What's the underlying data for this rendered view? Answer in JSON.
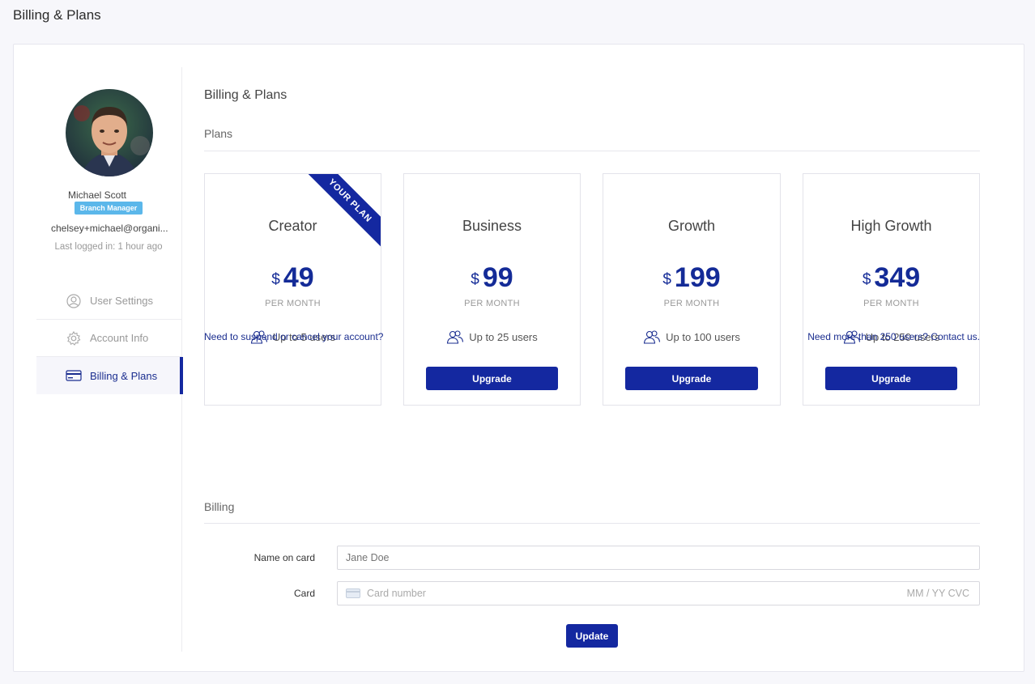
{
  "page": {
    "title": "Billing & Plans"
  },
  "profile": {
    "name": "Michael Scott",
    "role": "Branch Manager",
    "email": "chelsey+michael@organi...",
    "last_login": "Last logged in: 1 hour ago"
  },
  "nav": {
    "items": [
      {
        "label": "User Settings",
        "icon": "user-circle-icon"
      },
      {
        "label": "Account Info",
        "icon": "gear-icon"
      },
      {
        "label": "Billing & Plans",
        "icon": "credit-card-icon"
      }
    ],
    "active": "Billing & Plans"
  },
  "main": {
    "title": "Billing & Plans",
    "plans_title": "Plans",
    "ribbon": "YOUR PLAN",
    "plans": [
      {
        "name": "Creator",
        "currency": "$",
        "price": "49",
        "period": "PER MONTH",
        "users": "Up to 5 users",
        "current": true
      },
      {
        "name": "Business",
        "currency": "$",
        "price": "99",
        "period": "PER MONTH",
        "users": "Up to 25 users",
        "button": "Upgrade"
      },
      {
        "name": "Growth",
        "currency": "$",
        "price": "199",
        "period": "PER MONTH",
        "users": "Up to 100 users",
        "button": "Upgrade"
      },
      {
        "name": "High Growth",
        "currency": "$",
        "price": "349",
        "period": "PER MONTH",
        "users": "Up to 250 users",
        "button": "Upgrade"
      }
    ],
    "cancel_link": "Need to suspend or cancel your account?",
    "contact_link": "Need more than 250 users? Contact us.",
    "billing_title": "Billing",
    "form": {
      "name_label": "Name on card",
      "name_placeholder": "Jane Doe",
      "card_label": "Card",
      "card_placeholder": "Card number",
      "card_meta": "MM / YY  CVC",
      "update_label": "Update"
    }
  },
  "colors": {
    "accent": "#1428a0",
    "badge": "#5bb7ea"
  }
}
